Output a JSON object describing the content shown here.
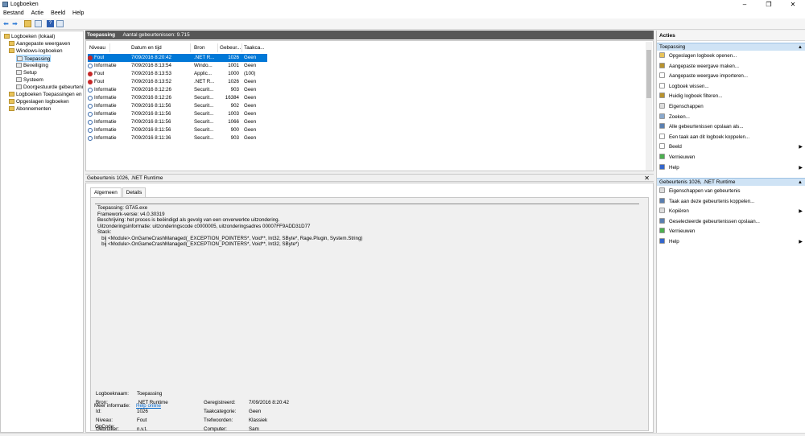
{
  "window": {
    "title": "Logboeken",
    "controls": [
      "–",
      "❐",
      "✕"
    ]
  },
  "menu": [
    "Bestand",
    "Actie",
    "Beeld",
    "Help"
  ],
  "tree": {
    "items": [
      {
        "label": "Logboeken (lokaal)",
        "indent": 0,
        "selected": false
      },
      {
        "label": "Aangepaste weergaven",
        "indent": 1,
        "selected": false
      },
      {
        "label": "Windows-logboeken",
        "indent": 1,
        "selected": false
      },
      {
        "label": "Toepassing",
        "indent": 2,
        "selected": true
      },
      {
        "label": "Beveiliging",
        "indent": 2,
        "selected": false
      },
      {
        "label": "Setup",
        "indent": 2,
        "selected": false
      },
      {
        "label": "Systeem",
        "indent": 2,
        "selected": false
      },
      {
        "label": "Doorgestuurde gebeurtenissen",
        "indent": 2,
        "selected": false
      },
      {
        "label": "Logboeken Toepassingen en services",
        "indent": 1,
        "selected": false
      },
      {
        "label": "Opgeslagen logboeken",
        "indent": 1,
        "selected": false
      },
      {
        "label": "Abonnementen",
        "indent": 1,
        "selected": false
      }
    ]
  },
  "center": {
    "title": "Toepassing",
    "count_label": "Aantal gebeurtenissen: 9.715",
    "columns": [
      "Niveau",
      "Datum en tijd",
      "Bron",
      "Gebeur...",
      "Taakca..."
    ],
    "events": [
      {
        "level": "Fout",
        "date": "7/09/2016 8:20:42",
        "source": ".NET R...",
        "id": "1026",
        "task": "Geen",
        "selected": true
      },
      {
        "level": "Informatie",
        "date": "7/09/2016 8:13:54",
        "source": "Windo...",
        "id": "1001",
        "task": "Geen",
        "selected": false
      },
      {
        "level": "Fout",
        "date": "7/09/2016 8:13:53",
        "source": "Applic...",
        "id": "1000",
        "task": "(100)",
        "selected": false
      },
      {
        "level": "Fout",
        "date": "7/09/2016 8:13:52",
        "source": ".NET R...",
        "id": "1026",
        "task": "Geen",
        "selected": false
      },
      {
        "level": "Informatie",
        "date": "7/09/2016 8:12:26",
        "source": "Securit...",
        "id": "903",
        "task": "Geen",
        "selected": false
      },
      {
        "level": "Informatie",
        "date": "7/09/2016 8:12:26",
        "source": "Securit...",
        "id": "16384",
        "task": "Geen",
        "selected": false
      },
      {
        "level": "Informatie",
        "date": "7/09/2016 8:11:56",
        "source": "Securit...",
        "id": "902",
        "task": "Geen",
        "selected": false
      },
      {
        "level": "Informatie",
        "date": "7/09/2016 8:11:56",
        "source": "Securit...",
        "id": "1003",
        "task": "Geen",
        "selected": false
      },
      {
        "level": "Informatie",
        "date": "7/09/2016 8:11:56",
        "source": "Securit...",
        "id": "1066",
        "task": "Geen",
        "selected": false
      },
      {
        "level": "Informatie",
        "date": "7/09/2016 8:11:56",
        "source": "Securit...",
        "id": "900",
        "task": "Geen",
        "selected": false
      },
      {
        "level": "Informatie",
        "date": "7/09/2016 8:11:36",
        "source": "Securit...",
        "id": "903",
        "task": "Geen",
        "selected": false
      }
    ]
  },
  "detail": {
    "title": "Gebeurtenis 1026, .NET Runtime",
    "close": "✕",
    "tabs": [
      "Algemeen",
      "Details"
    ],
    "description": [
      "Toepassing: GTA5.exe",
      "Framework-versie: v4.0.30319",
      "Beschrijving: het proces is beëindigd als gevolg van een onverwerkte uitzondering.",
      "Uitzonderingsinformatie: uitzonderingscode c0000005, uitzonderingsadres 00007FF9ADD31D77",
      "Stack:",
      "   bij <Module>.OnGameCrashManaged(_EXCEPTION_POINTERS*, Void**, Int32, SByte*, Rage.Plugin, System.String)",
      "   bij <Module>.OnGameCrashManaged(_EXCEPTION_POINTERS*, Void**, Int32, SByte*)"
    ],
    "props": {
      "logname_label": "Logboeknaam:",
      "logname": "Toepassing",
      "source_label": "Bron:",
      "source": ".NET Runtime",
      "logged_label": "Geregistreerd:",
      "logged": "7/09/2016 8:20:42",
      "id_label": "Id:",
      "id": "1026",
      "task_label": "Taakcategorie:",
      "task": "Geen",
      "level_label": "Niveau:",
      "level": "Fout",
      "keywords_label": "Trefwoorden:",
      "keywords": "Klassiek",
      "user_label": "Gebruiker:",
      "user": "n.v.t.",
      "computer_label": "Computer:",
      "computer": "Sam",
      "opcode_label": "OpCode:",
      "more_label": "Meer informatie:",
      "more_link": "Help online"
    }
  },
  "actions": {
    "title": "Acties",
    "section1": "Toepassing",
    "items1": [
      {
        "label": "Opgeslagen logboek openen...",
        "color": "#e8c35a",
        "sub": false
      },
      {
        "label": "Aangepaste weergave maken...",
        "color": "#b8922e",
        "sub": false
      },
      {
        "label": "Aangepaste weergave importeren...",
        "color": "#ffffff",
        "sub": false
      },
      {
        "label": "Logboek wissen...",
        "color": "#ffffff",
        "sub": false
      },
      {
        "label": "Huidig logboek filteren...",
        "color": "#b8922e",
        "sub": false
      },
      {
        "label": "Eigenschappen",
        "color": "#dddddd",
        "sub": false
      },
      {
        "label": "Zoeken...",
        "color": "#8aa9cc",
        "sub": false
      },
      {
        "label": "Alle gebeurtenissen opslaan als...",
        "color": "#5a7fb0",
        "sub": false
      },
      {
        "label": "Een taak aan dit logboek koppelen...",
        "color": "#ffffff",
        "sub": false
      },
      {
        "label": "Beeld",
        "color": "#ffffff",
        "sub": true
      },
      {
        "label": "Vernieuwen",
        "color": "#4caf50",
        "sub": false
      },
      {
        "label": "Help",
        "color": "#3366cc",
        "sub": true
      }
    ],
    "section2": "Gebeurtenis 1026, .NET Runtime",
    "items2": [
      {
        "label": "Eigenschappen van gebeurtenis",
        "color": "#dddddd",
        "sub": false
      },
      {
        "label": "Taak aan deze gebeurtenis koppelen...",
        "color": "#5a7fb0",
        "sub": false
      },
      {
        "label": "Kopiëren",
        "color": "#dddddd",
        "sub": true
      },
      {
        "label": "Geselecteerde gebeurtenissen opslaan...",
        "color": "#5a7fb0",
        "sub": false
      },
      {
        "label": "Vernieuwen",
        "color": "#4caf50",
        "sub": false
      },
      {
        "label": "Help",
        "color": "#3366cc",
        "sub": true
      }
    ]
  }
}
